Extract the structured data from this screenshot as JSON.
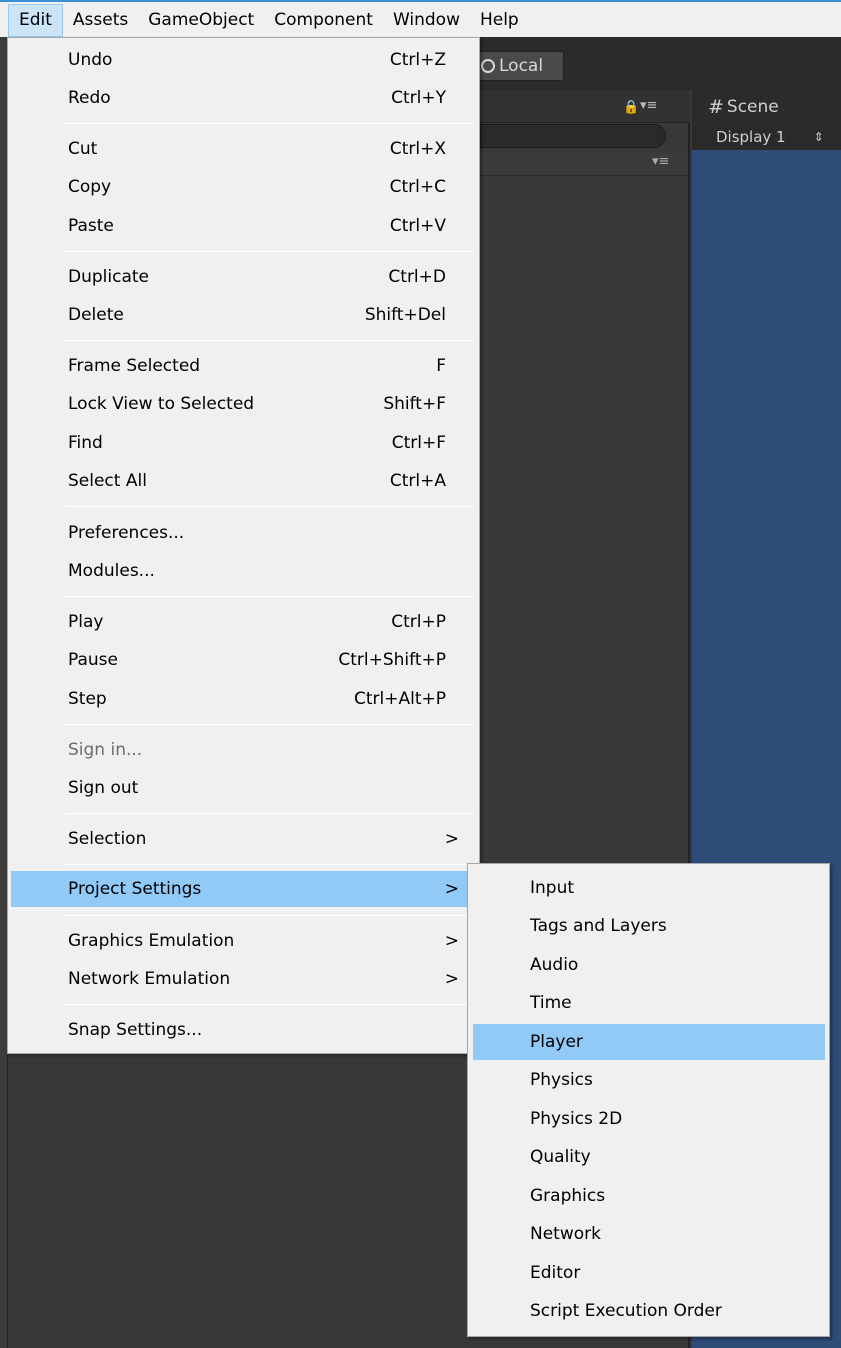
{
  "menubar": {
    "items": [
      "Edit",
      "Assets",
      "GameObject",
      "Component",
      "Window",
      "Help"
    ]
  },
  "toolbar": {
    "local_label": "Local"
  },
  "scene": {
    "tab_label": "Scene",
    "display_label": "Display 1"
  },
  "edit_menu": {
    "items": [
      {
        "label": "Undo",
        "shortcut": "Ctrl+Z"
      },
      {
        "label": "Redo",
        "shortcut": "Ctrl+Y"
      },
      {
        "label": "Cut",
        "shortcut": "Ctrl+X"
      },
      {
        "label": "Copy",
        "shortcut": "Ctrl+C"
      },
      {
        "label": "Paste",
        "shortcut": "Ctrl+V"
      },
      {
        "label": "Duplicate",
        "shortcut": "Ctrl+D"
      },
      {
        "label": "Delete",
        "shortcut": "Shift+Del"
      },
      {
        "label": "Frame Selected",
        "shortcut": "F"
      },
      {
        "label": "Lock View to Selected",
        "shortcut": "Shift+F"
      },
      {
        "label": "Find",
        "shortcut": "Ctrl+F"
      },
      {
        "label": "Select All",
        "shortcut": "Ctrl+A"
      },
      {
        "label": "Preferences...",
        "shortcut": ""
      },
      {
        "label": "Modules...",
        "shortcut": ""
      },
      {
        "label": "Play",
        "shortcut": "Ctrl+P"
      },
      {
        "label": "Pause",
        "shortcut": "Ctrl+Shift+P"
      },
      {
        "label": "Step",
        "shortcut": "Ctrl+Alt+P"
      },
      {
        "label": "Sign in...",
        "shortcut": ""
      },
      {
        "label": "Sign out",
        "shortcut": ""
      },
      {
        "label": "Selection",
        "shortcut": ""
      },
      {
        "label": "Project Settings",
        "shortcut": ""
      },
      {
        "label": "Graphics Emulation",
        "shortcut": ""
      },
      {
        "label": "Network Emulation",
        "shortcut": ""
      },
      {
        "label": "Snap Settings...",
        "shortcut": ""
      }
    ],
    "submenu_arrow": ">"
  },
  "project_settings_menu": {
    "items": [
      "Input",
      "Tags and Layers",
      "Audio",
      "Time",
      "Player",
      "Physics",
      "Physics 2D",
      "Quality",
      "Graphics",
      "Network",
      "Editor",
      "Script Execution Order"
    ],
    "highlighted": "Player"
  },
  "colors": {
    "menu_bg": "#f0f0f0",
    "highlight": "#91c9f7",
    "scene_bg": "#2f4b78",
    "editor_dark": "#383838"
  }
}
